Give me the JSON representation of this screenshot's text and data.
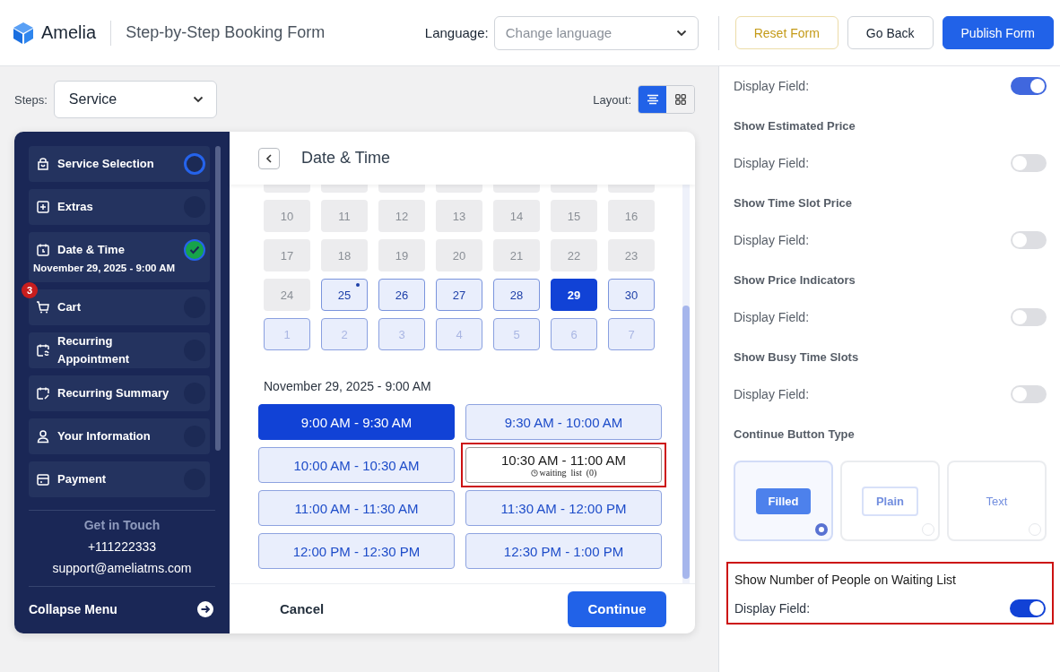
{
  "header": {
    "logo_text": "Amelia",
    "title": "Step-by-Step Booking Form",
    "language_label": "Language:",
    "language_placeholder": "Change language",
    "buttons": [
      {
        "label": "Reset Form",
        "kind": "warning"
      },
      {
        "label": "Go Back",
        "kind": "outline"
      },
      {
        "label": "Publish Form",
        "kind": "primary"
      }
    ]
  },
  "toolbar": {
    "steps_label": "Steps:",
    "steps_value": "Service",
    "layout_label": "Layout:",
    "layout_options": [
      {
        "selected": true
      },
      {
        "selected": false
      }
    ]
  },
  "sidebar": {
    "steps": [
      {
        "label": "Service Selection",
        "current": true,
        "done": false
      },
      {
        "label": "Extras",
        "current": false,
        "done": false
      },
      {
        "label": "Date & Time",
        "subtitle": "November 29, 2025 - 9:00 AM",
        "current": false,
        "done": true
      },
      {
        "label": "Cart",
        "current": false,
        "done": false,
        "badge": "3"
      },
      {
        "label": "Recurring Appointment",
        "current": false,
        "done": false
      },
      {
        "label": "Recurring Summary",
        "current": false,
        "done": false
      },
      {
        "label": "Your Information",
        "current": false,
        "done": false
      },
      {
        "label": "Payment",
        "current": false,
        "done": false
      }
    ],
    "contact_title": "Get in Touch",
    "phone": "+111222333",
    "email": "support@ameliatms.com",
    "collapse_label": "Collapse Menu"
  },
  "panel": {
    "title": "Date & Time",
    "calendar": [
      [
        {
          "day": "10",
          "disabled": true,
          "selected": false,
          "other_month": false
        },
        {
          "day": "11",
          "disabled": true,
          "selected": false,
          "other_month": false
        },
        {
          "day": "12",
          "disabled": true,
          "selected": false,
          "other_month": false
        },
        {
          "day": "13",
          "disabled": true,
          "selected": false,
          "other_month": false
        },
        {
          "day": "14",
          "disabled": true,
          "selected": false,
          "other_month": false
        },
        {
          "day": "15",
          "disabled": true,
          "selected": false,
          "other_month": false
        },
        {
          "day": "16",
          "disabled": true,
          "selected": false,
          "other_month": false
        }
      ],
      [
        {
          "day": "17",
          "disabled": true,
          "selected": false,
          "other_month": false
        },
        {
          "day": "18",
          "disabled": true,
          "selected": false,
          "other_month": false
        },
        {
          "day": "19",
          "disabled": true,
          "selected": false,
          "other_month": false
        },
        {
          "day": "20",
          "disabled": true,
          "selected": false,
          "other_month": false
        },
        {
          "day": "21",
          "disabled": true,
          "selected": false,
          "other_month": false
        },
        {
          "day": "22",
          "disabled": true,
          "selected": false,
          "other_month": false
        },
        {
          "day": "23",
          "disabled": true,
          "selected": false,
          "other_month": false
        }
      ],
      [
        {
          "day": "24",
          "disabled": true,
          "selected": false,
          "other_month": false
        },
        {
          "day": "25",
          "disabled": false,
          "selected": false,
          "other_month": false,
          "dot": true
        },
        {
          "day": "26",
          "disabled": false,
          "selected": false,
          "other_month": false
        },
        {
          "day": "27",
          "disabled": false,
          "selected": false,
          "other_month": false
        },
        {
          "day": "28",
          "disabled": false,
          "selected": false,
          "other_month": false
        },
        {
          "day": "29",
          "disabled": false,
          "selected": true,
          "other_month": false
        },
        {
          "day": "30",
          "disabled": false,
          "selected": false,
          "other_month": false
        }
      ],
      [
        {
          "day": "1",
          "disabled": false,
          "selected": false,
          "other_month": true
        },
        {
          "day": "2",
          "disabled": false,
          "selected": false,
          "other_month": true
        },
        {
          "day": "3",
          "disabled": false,
          "selected": false,
          "other_month": true
        },
        {
          "day": "4",
          "disabled": false,
          "selected": false,
          "other_month": true
        },
        {
          "day": "5",
          "disabled": false,
          "selected": false,
          "other_month": true
        },
        {
          "day": "6",
          "disabled": false,
          "selected": false,
          "other_month": true
        },
        {
          "day": "7",
          "disabled": false,
          "selected": false,
          "other_month": true
        }
      ]
    ],
    "selected_datetime": "November 29, 2025 - 9:00 AM",
    "slots": [
      {
        "label": "9:00 AM - 9:30 AM",
        "selected": true,
        "highlighted": false
      },
      {
        "label": "9:30 AM - 10:00 AM",
        "selected": false,
        "highlighted": false
      },
      {
        "label": "10:00 AM - 10:30 AM",
        "selected": false,
        "highlighted": false
      },
      {
        "label": "10:30 AM - 11:00 AM",
        "note": "waiting  list  (0)",
        "selected": false,
        "highlighted": true
      },
      {
        "label": "11:00 AM - 11:30 AM",
        "selected": false,
        "highlighted": false
      },
      {
        "label": "11:30 AM - 12:00 PM",
        "selected": false,
        "highlighted": false
      },
      {
        "label": "12:00 PM - 12:30 PM",
        "selected": false,
        "highlighted": false
      },
      {
        "label": "12:30 PM - 1:00 PM",
        "selected": false,
        "highlighted": false
      }
    ],
    "cancel_label": "Cancel",
    "continue_label": "Continue"
  },
  "settings": [
    {
      "kind": "toggle",
      "label": "Display Field:",
      "on": true,
      "blurred": true
    },
    {
      "kind": "toggle",
      "title": "Show Estimated Price",
      "label": "Display Field:",
      "on": false,
      "blurred": true
    },
    {
      "kind": "toggle",
      "title": "Show Time Slot Price",
      "label": "Display Field:",
      "on": false,
      "blurred": true
    },
    {
      "kind": "toggle",
      "title": "Show Price Indicators",
      "label": "Display Field:",
      "on": false,
      "blurred": true
    },
    {
      "kind": "toggle",
      "title": "Show Busy Time Slots",
      "label": "Display Field:",
      "on": false,
      "blurred": true
    },
    {
      "kind": "button_type",
      "title": "Continue Button Type",
      "blurred": true,
      "options": [
        {
          "label": "Filled",
          "selected": true
        },
        {
          "label": "Plain",
          "selected": false
        },
        {
          "label": "Text",
          "selected": false
        }
      ]
    },
    {
      "kind": "toggle",
      "title": "Show Number of People on Waiting List",
      "label": "Display Field:",
      "on": true,
      "blurred": false,
      "highlighted": true
    }
  ]
}
